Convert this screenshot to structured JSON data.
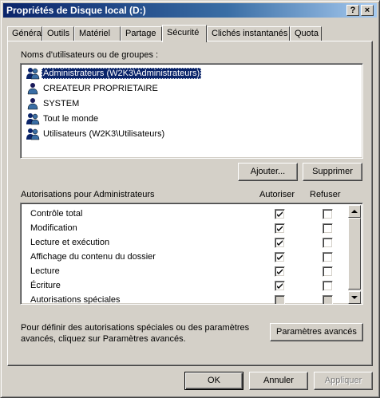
{
  "window": {
    "title": "Propriétés de Disque local (D:)",
    "help_button": "?",
    "close_button": "×"
  },
  "tabs": [
    {
      "label": "Général"
    },
    {
      "label": "Outils"
    },
    {
      "label": "Matériel"
    },
    {
      "label": "Partage"
    },
    {
      "label": "Sécurité",
      "active": true
    },
    {
      "label": "Clichés instantanés"
    },
    {
      "label": "Quota"
    }
  ],
  "users": {
    "label": "Noms d'utilisateurs ou de groupes :",
    "items": [
      {
        "name": "Administrateurs (W2K3\\Administrateurs)",
        "selected": true
      },
      {
        "name": "CREATEUR PROPRIETAIRE"
      },
      {
        "name": "SYSTEM"
      },
      {
        "name": "Tout le monde"
      },
      {
        "name": "Utilisateurs (W2K3\\Utilisateurs)"
      }
    ],
    "add_button": "Ajouter...",
    "remove_button": "Supprimer"
  },
  "permissions": {
    "label": "Autorisations pour Administrateurs",
    "allow_header": "Autoriser",
    "deny_header": "Refuser",
    "rows": [
      {
        "name": "Contrôle total",
        "allow": true,
        "deny": false
      },
      {
        "name": "Modification",
        "allow": true,
        "deny": false
      },
      {
        "name": "Lecture et exécution",
        "allow": true,
        "deny": false
      },
      {
        "name": "Affichage du contenu du dossier",
        "allow": true,
        "deny": false
      },
      {
        "name": "Lecture",
        "allow": true,
        "deny": false
      },
      {
        "name": "Écriture",
        "allow": true,
        "deny": false
      },
      {
        "name": "Autorisations spéciales",
        "allow": false,
        "deny": false,
        "disabled": true
      }
    ]
  },
  "advanced": {
    "text_line1": "Pour définir des autorisations spéciales ou des paramètres",
    "text_line2": "avancés, cliquez sur Paramètres avancés.",
    "button": "Paramètres avancés"
  },
  "footer": {
    "ok": "OK",
    "cancel": "Annuler",
    "apply": "Appliquer"
  }
}
